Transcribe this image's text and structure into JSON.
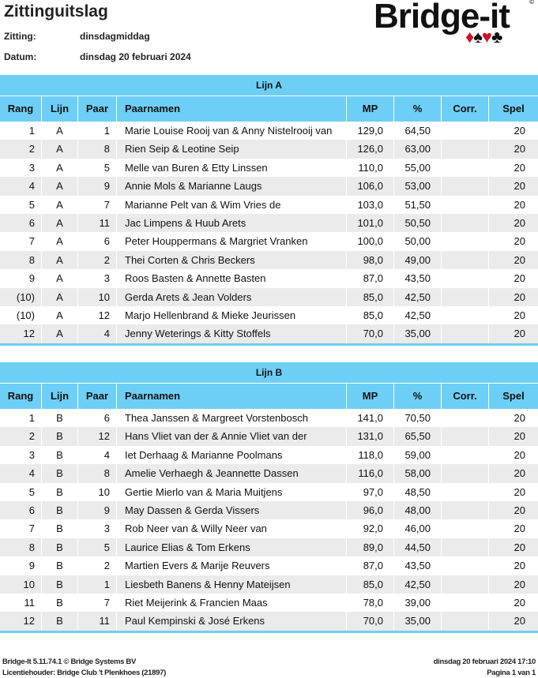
{
  "header": {
    "title": "Zittinguitslag",
    "zitting_label": "Zitting:",
    "zitting_value": "dinsdagmiddag",
    "datum_label": "Datum:",
    "datum_value": "dinsdag 20 februari 2024",
    "logo_text": "Bridge-it",
    "logo_copyright": "©"
  },
  "columns": [
    "Rang",
    "Lijn",
    "Paar",
    "Paarnamen",
    "MP",
    "%",
    "Corr.",
    "Spel"
  ],
  "sections": [
    {
      "title": "Lijn A",
      "rows": [
        [
          "1",
          "A",
          "1",
          "Marie Louise Rooij van & Anny Nistelrooij van",
          "129,0",
          "64,50",
          "",
          "20"
        ],
        [
          "2",
          "A",
          "8",
          "Rien Seip & Leotine Seip",
          "126,0",
          "63,00",
          "",
          "20"
        ],
        [
          "3",
          "A",
          "5",
          "Melle van Buren & Etty Linssen",
          "110,0",
          "55,00",
          "",
          "20"
        ],
        [
          "4",
          "A",
          "9",
          "Annie Mols & Marianne Laugs",
          "106,0",
          "53,00",
          "",
          "20"
        ],
        [
          "5",
          "A",
          "7",
          "Marianne Pelt van & Wim Vries de",
          "103,0",
          "51,50",
          "",
          "20"
        ],
        [
          "6",
          "A",
          "11",
          "Jac Limpens & Huub Arets",
          "101,0",
          "50,50",
          "",
          "20"
        ],
        [
          "7",
          "A",
          "6",
          "Peter Houppermans & Margriet Vranken",
          "100,0",
          "50,00",
          "",
          "20"
        ],
        [
          "8",
          "A",
          "2",
          "Thei Corten & Chris Beckers",
          "98,0",
          "49,00",
          "",
          "20"
        ],
        [
          "9",
          "A",
          "3",
          "Roos Basten & Annette Basten",
          "87,0",
          "43,50",
          "",
          "20"
        ],
        [
          "(10)",
          "A",
          "10",
          "Gerda Arets & Jean Volders",
          "85,0",
          "42,50",
          "",
          "20"
        ],
        [
          "(10)",
          "A",
          "12",
          "Marjo Hellenbrand & Mieke Jeurissen",
          "85,0",
          "42,50",
          "",
          "20"
        ],
        [
          "12",
          "A",
          "4",
          "Jenny Weterings & Kitty Stoffels",
          "70,0",
          "35,00",
          "",
          "20"
        ]
      ]
    },
    {
      "title": "Lijn B",
      "rows": [
        [
          "1",
          "B",
          "6",
          "Thea Janssen & Margreet Vorstenbosch",
          "141,0",
          "70,50",
          "",
          "20"
        ],
        [
          "2",
          "B",
          "12",
          "Hans  Vliet van der & Annie Vliet van der",
          "131,0",
          "65,50",
          "",
          "20"
        ],
        [
          "3",
          "B",
          "4",
          "Iet Derhaag & Marianne Poolmans",
          "118,0",
          "59,00",
          "",
          "20"
        ],
        [
          "4",
          "B",
          "8",
          "Amelie Verhaegh & Jeannette Dassen",
          "116,0",
          "58,00",
          "",
          "20"
        ],
        [
          "5",
          "B",
          "10",
          "Gertie Mierlo van & Maria Muitjens",
          "97,0",
          "48,50",
          "",
          "20"
        ],
        [
          "6",
          "B",
          "9",
          "May Dassen & Gerda Vissers",
          "96,0",
          "48,00",
          "",
          "20"
        ],
        [
          "7",
          "B",
          "3",
          "Rob  Neer van & Willy Neer van",
          "92,0",
          "46,00",
          "",
          "20"
        ],
        [
          "8",
          "B",
          "5",
          "Laurice Elias & Tom Erkens",
          "89,0",
          "44,50",
          "",
          "20"
        ],
        [
          "9",
          "B",
          "2",
          "Martien Evers & Marije Reuvers",
          "87,0",
          "43,50",
          "",
          "20"
        ],
        [
          "10",
          "B",
          "1",
          "Liesbeth Banens & Henny Mateijsen",
          "85,0",
          "42,50",
          "",
          "20"
        ],
        [
          "11",
          "B",
          "7",
          "Riet Meijerink & Francien Maas",
          "78,0",
          "39,00",
          "",
          "20"
        ],
        [
          "12",
          "B",
          "11",
          "Paul Kempinski & José Erkens",
          "70,0",
          "35,00",
          "",
          "20"
        ]
      ]
    }
  ],
  "footer": {
    "version": "Bridge-It 5.11.74.1 © Bridge Systems BV",
    "license": "Licentiehouder: Bridge Club 't Plenkhoes (21897)",
    "printed": "dinsdag 20 februari 2024 17:10",
    "page": "Pagina 1 van 1"
  },
  "colors": {
    "accent": "#6dcff6",
    "row_alt": "#ebebeb",
    "suit_red": "#d0102a"
  }
}
